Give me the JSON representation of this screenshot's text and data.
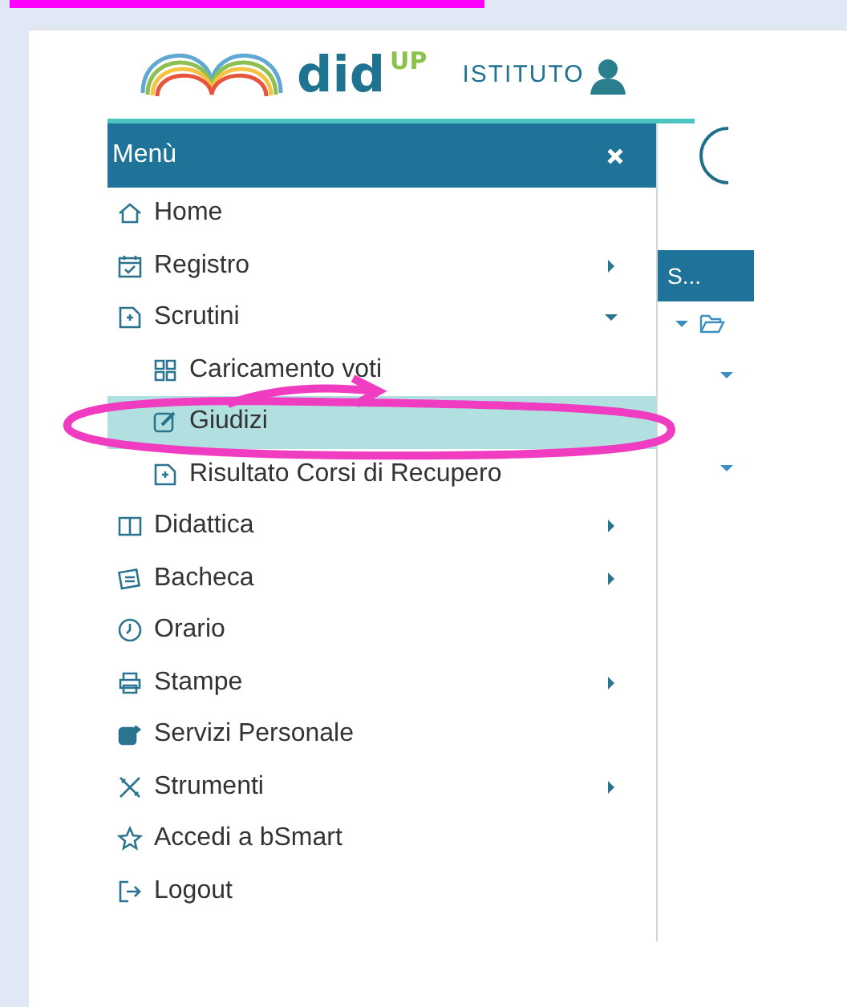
{
  "logo": {
    "name": "did",
    "superscript": "UP"
  },
  "school_label": "ISTITUTO",
  "menu": {
    "title": "Menù",
    "items": [
      {
        "label": "Home",
        "selected": false
      },
      {
        "label": "Registro",
        "expanded": false,
        "selected": false
      },
      {
        "label": "Scrutini",
        "expanded": true,
        "selected": false,
        "children": [
          {
            "label": "Caricamento voti",
            "selected": false
          },
          {
            "label": "Giudizi",
            "selected": true
          },
          {
            "label": "Risultato Corsi di Recupero",
            "selected": false
          }
        ]
      },
      {
        "label": "Didattica",
        "expanded": false,
        "selected": false
      },
      {
        "label": "Bacheca",
        "expanded": false,
        "selected": false
      },
      {
        "label": "Orario",
        "selected": false
      },
      {
        "label": "Stampe",
        "expanded": false,
        "selected": false
      },
      {
        "label": "Servizi Personale",
        "selected": false
      },
      {
        "label": "Strumenti",
        "expanded": false,
        "selected": false
      },
      {
        "label": "Accedi a bSmart",
        "selected": false
      },
      {
        "label": "Logout",
        "selected": false
      }
    ]
  },
  "side_panel": {
    "header": "S..."
  }
}
